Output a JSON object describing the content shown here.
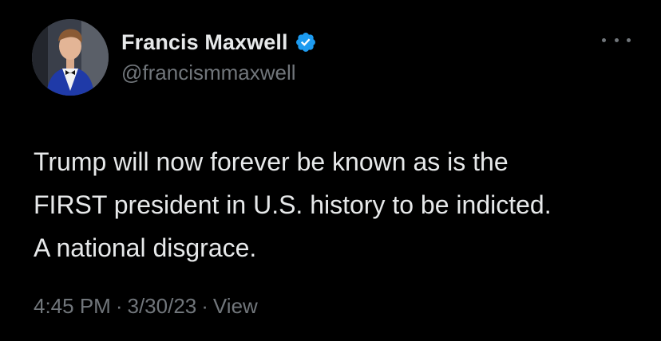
{
  "author": {
    "display_name": "Francis Maxwell",
    "handle": "@francismmaxwell",
    "verified": true,
    "verified_color": "#1d9bf0"
  },
  "more_menu": {
    "icon": "more-horizontal-icon"
  },
  "tweet": {
    "lines": [
      "Trump will now forever be known as is the",
      "FIRST president in U.S. history to be indicted.",
      "A national disgrace."
    ]
  },
  "meta": {
    "time": "4:45 PM",
    "separator": "·",
    "date": "3/30/23",
    "view_label": "View"
  },
  "colors": {
    "background": "#000000",
    "primary_text": "#e7e9ea",
    "secondary_text": "#71767b"
  }
}
